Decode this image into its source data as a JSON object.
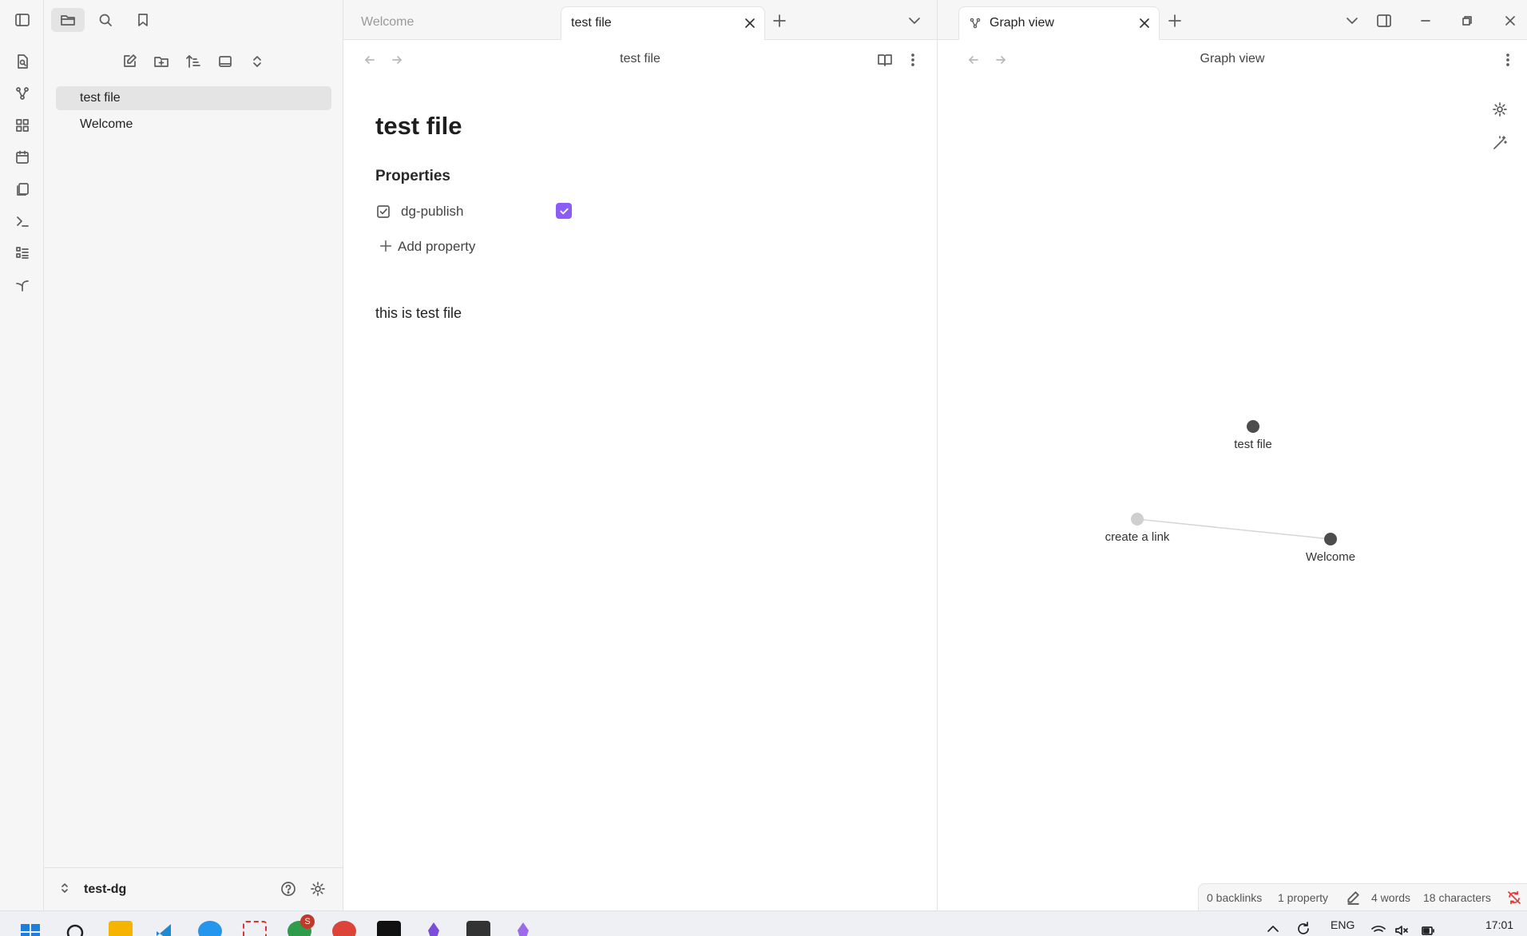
{
  "sidebar": {
    "files": [
      "test file",
      "Welcome"
    ],
    "vault_name": "test-dg"
  },
  "main_tabs": [
    {
      "label": "Welcome",
      "active": false
    },
    {
      "label": "test file",
      "active": true
    }
  ],
  "main_view": {
    "header_title": "test file",
    "note_title": "test file",
    "properties_heading": "Properties",
    "property_key": "dg-publish",
    "property_checked": true,
    "add_property_label": "Add property",
    "body_text": "this is test file"
  },
  "graph_tab": {
    "label": "Graph view"
  },
  "graph_view": {
    "header_title": "Graph view",
    "nodes": [
      "test file",
      "create a link",
      "Welcome"
    ]
  },
  "status_bar": {
    "backlinks": "0 backlinks",
    "properties": "1 property",
    "words": "4 words",
    "characters": "18 characters"
  },
  "taskbar": {
    "language": "ENG",
    "time": "17:01",
    "chrome_badge": "S"
  },
  "colors": {
    "accent": "#8b5cf6",
    "node_resolved": "#4d4d4d",
    "node_unresolved": "#cfcfcf"
  }
}
